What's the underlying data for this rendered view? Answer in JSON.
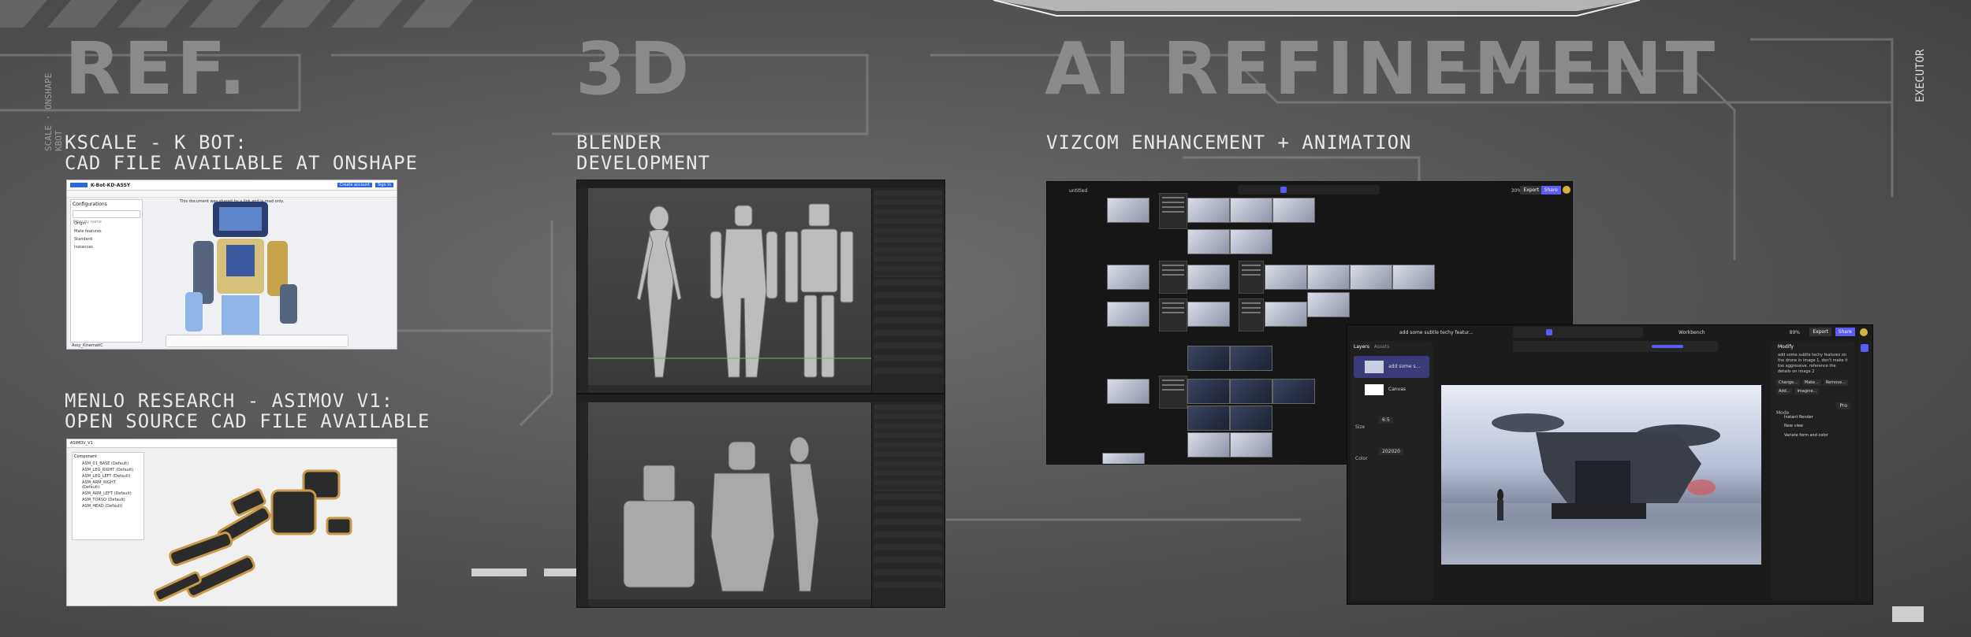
{
  "headings": {
    "ref": "REF.",
    "threed": "3D",
    "ai": "AI REFINEMENT"
  },
  "sections": {
    "kscale": {
      "line1": "KSCALE - K BOT:",
      "line2": "CAD FILE AVAILABLE AT ONSHAPE"
    },
    "menlo": {
      "line1": "MENLO RESEARCH - ASIMOV V1:",
      "line2": "OPEN SOURCE CAD FILE AVAILABLE"
    },
    "blender": {
      "line1": "BLENDER",
      "line2": "DEVELOPMENT"
    },
    "vizcom": {
      "line1": "VIZCOM ENHANCEMENT + ANIMATION"
    }
  },
  "onshape": {
    "doc_title": "K-Bot-KD-ASSY",
    "notice": "This document was shared by a link and is read only.",
    "create_btn": "Create account",
    "signin_btn": "Sign in",
    "panel_title": "Configurations",
    "search_placeholder": "Filter by name",
    "tree_items": [
      "Origin",
      "Mate features",
      "Standard",
      "Instances"
    ],
    "tab": "Assy_KinematiC"
  },
  "asimov": {
    "title": "ASIMOV_V1",
    "panel_title": "Component",
    "items": [
      "ASM_01_BASE (Default)",
      "ASM_LEG_RIGHT (Default)",
      "ASM_LEG_LEFT (Default)",
      "ASM_ARM_RIGHT (Default)",
      "ASM_ARM_LEFT (Default)",
      "ASM_TORSO (Default)",
      "ASM_HEAD (Default)"
    ]
  },
  "vizcom_main": {
    "project": "untitled",
    "zoom": "30%",
    "export": "Export",
    "share": "Share"
  },
  "vizcom_studio": {
    "prompt": "add some subtle techy featur...",
    "layers_tab": "Layers",
    "assets_tab": "Assets",
    "layer1": "add some s...",
    "layer2": "Canvas",
    "size_label": "Size",
    "size_value": "6:5",
    "color_label": "Color",
    "color_value": "202020",
    "zoom": "89%",
    "export": "Export",
    "share": "Share",
    "workbench": "Workbench",
    "modify_title": "Modify",
    "modify_text": "add some subtle techy features on the drone in image 1, don't make it too aggressive. reference the details on image 2",
    "chips": [
      "Change...",
      "Make...",
      "Remove...",
      "Add...",
      "Imagine..."
    ],
    "mode_label": "Mode",
    "mode_value": "Pro",
    "actions": [
      "Instant Render",
      "New view",
      "Variate form and color"
    ]
  },
  "colors": {
    "accent": "#5b5bf5",
    "bg": "#5b5b5c",
    "heading": "#8a8a8c"
  }
}
